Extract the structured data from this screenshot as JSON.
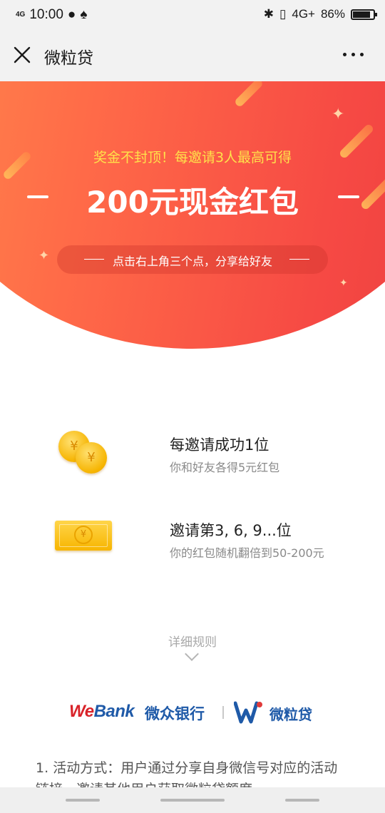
{
  "status_bar": {
    "network": "4G",
    "time": "10:00",
    "network_right": "4G+",
    "battery": "86%",
    "battery_level": 0.86
  },
  "nav": {
    "title": "微粒贷",
    "close_icon": "close-icon",
    "more_icon": "more-icon"
  },
  "banner": {
    "tagline": "奖金不封顶！每邀请3人最高可得",
    "headline": "200元现金红包",
    "share_hint": "点击右上角三个点，分享给好友",
    "colors": {
      "start": "#ff8a4c",
      "end": "#ea3e3d",
      "tagline": "#ffe14a"
    }
  },
  "features": [
    {
      "icon": "coins-icon",
      "title": "每邀请成功1位",
      "desc": "你和好友各得5元红包"
    },
    {
      "icon": "cash-bill-icon",
      "title": "邀请第3, 6, 9...位",
      "desc": "你的红包随机翻倍到50-200元"
    }
  ],
  "coin_symbol": "¥",
  "rules_link": "详细规则",
  "brand": {
    "webank_we": "We",
    "webank_bank": "Bank",
    "webank_cn": "微众银行",
    "product_cn": "微粒贷"
  },
  "rules": [
    {
      "num": "1.",
      "text": "活动方式：用户通过分享自身微信号对应的活动链接，邀请其他用户获取微粒贷额度"
    }
  ]
}
